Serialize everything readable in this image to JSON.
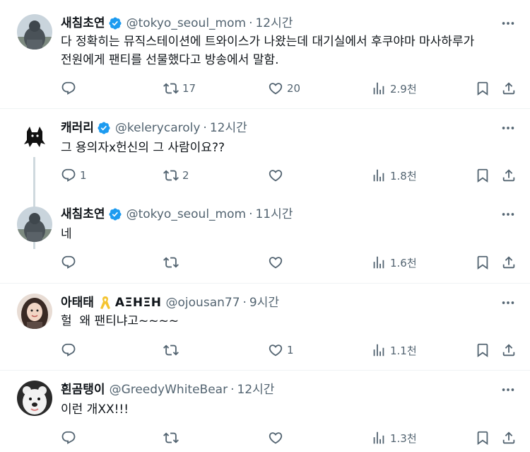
{
  "tweets": [
    {
      "name": "새침초연",
      "handle": "@tokyo_seoul_mom",
      "time": "12시간",
      "text": "다 정확히는 뮤직스테이션에 트와이스가 나왔는데 대기실에서 후쿠야마 마사하루가\n전원에게 팬티를 선물했다고 방송에서 말함.",
      "replies": "",
      "retweets": "17",
      "likes": "20",
      "views": "2.9천"
    },
    {
      "name": "캐러리",
      "handle": "@kelerycaroly",
      "time": "12시간",
      "text": "그 용의자x헌신의 그 사람이요??",
      "replies": "1",
      "retweets": "2",
      "likes": "",
      "views": "1.8천"
    },
    {
      "name": "새침초연",
      "handle": "@tokyo_seoul_mom",
      "time": "11시간",
      "text": "네",
      "replies": "",
      "retweets": "",
      "likes": "",
      "views": "1.6천"
    },
    {
      "name": "아태태",
      "extra": "ΑΞΗΞΗ",
      "handle": "@ojousan77",
      "time": "9시간",
      "text": "헐  왜 팬티냐고~~~~",
      "replies": "",
      "retweets": "",
      "likes": "1",
      "views": "1.1천"
    },
    {
      "name": "흰곰탱이",
      "handle": "@GreedyWhiteBear",
      "time": "12시간",
      "text": "이런 개XX!!!",
      "replies": "",
      "retweets": "",
      "likes": "",
      "views": "1.3천"
    }
  ],
  "separator": "·",
  "colors": {
    "text": "#0f1419",
    "muted": "#536471",
    "verified": "#1d9bf0",
    "divider": "#eff3f4",
    "ribbon": "#f4c430"
  }
}
